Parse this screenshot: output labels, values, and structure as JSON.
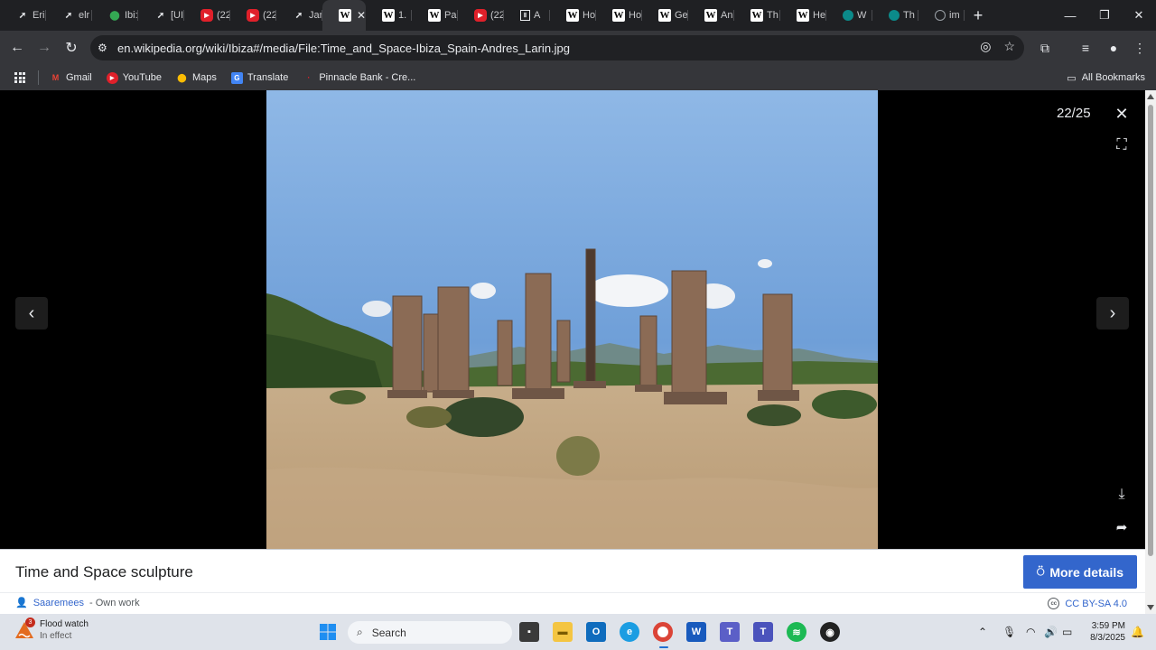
{
  "browser": {
    "tabs": [
      {
        "label": "Eri",
        "icon": "bird-icon"
      },
      {
        "label": "elr",
        "icon": "bird-icon"
      },
      {
        "label": "Ibi:",
        "icon": "maps-icon"
      },
      {
        "label": "[UI",
        "icon": "bird-icon"
      },
      {
        "label": "(22",
        "icon": "youtube-icon"
      },
      {
        "label": "(22",
        "icon": "youtube-icon"
      },
      {
        "label": "Jar",
        "icon": "bird-icon"
      },
      {
        "label": "",
        "icon": "wikipedia-icon",
        "active": true
      },
      {
        "label": "1.",
        "icon": "wikipedia-icon"
      },
      {
        "label": "Pa",
        "icon": "wikipedia-icon"
      },
      {
        "label": "(22",
        "icon": "youtube-icon"
      },
      {
        "label": "A",
        "icon": "document-icon"
      },
      {
        "label": "Ho",
        "icon": "wikipedia-icon"
      },
      {
        "label": "Ho",
        "icon": "wikipedia-icon"
      },
      {
        "label": "Ge",
        "icon": "wikipedia-icon"
      },
      {
        "label": "An",
        "icon": "wikipedia-icon"
      },
      {
        "label": "Th",
        "icon": "wikipedia-icon"
      },
      {
        "label": "He",
        "icon": "wikipedia-icon"
      },
      {
        "label": "W",
        "icon": "teal-icon"
      },
      {
        "label": "Th",
        "icon": "teal-icon"
      },
      {
        "label": "im",
        "icon": "globe-icon"
      }
    ],
    "url": "en.wikipedia.org/wiki/Ibiza#/media/File:Time_and_Space-Ibiza_Spain-Andres_Larin.jpg",
    "bookmarks": [
      {
        "label": "Gmail",
        "icon": "gmail-icon"
      },
      {
        "label": "YouTube",
        "icon": "youtube-icon"
      },
      {
        "label": "Maps",
        "icon": "maps-icon"
      },
      {
        "label": "Translate",
        "icon": "translate-icon"
      },
      {
        "label": "Pinnacle Bank - Cre...",
        "icon": "bank-icon"
      }
    ],
    "all_bookmarks": "All Bookmarks"
  },
  "viewer": {
    "counter": "22/25",
    "caption": "Time and Space sculpture",
    "more_details": "More details",
    "author": "Saaremees",
    "author_suffix": " - Own work",
    "license": "CC BY-SA 4.0"
  },
  "taskbar": {
    "weather_title": "Flood watch",
    "weather_sub": "In effect",
    "weather_badge": "3",
    "search_placeholder": "Search",
    "time": "3:59 PM",
    "date": "8/3/2025"
  },
  "colors": {
    "accent": "#3366cc",
    "tab_bg": "#1f2023",
    "toolbar_bg": "#35363a",
    "taskbar_bg": "#dfe3ea"
  }
}
